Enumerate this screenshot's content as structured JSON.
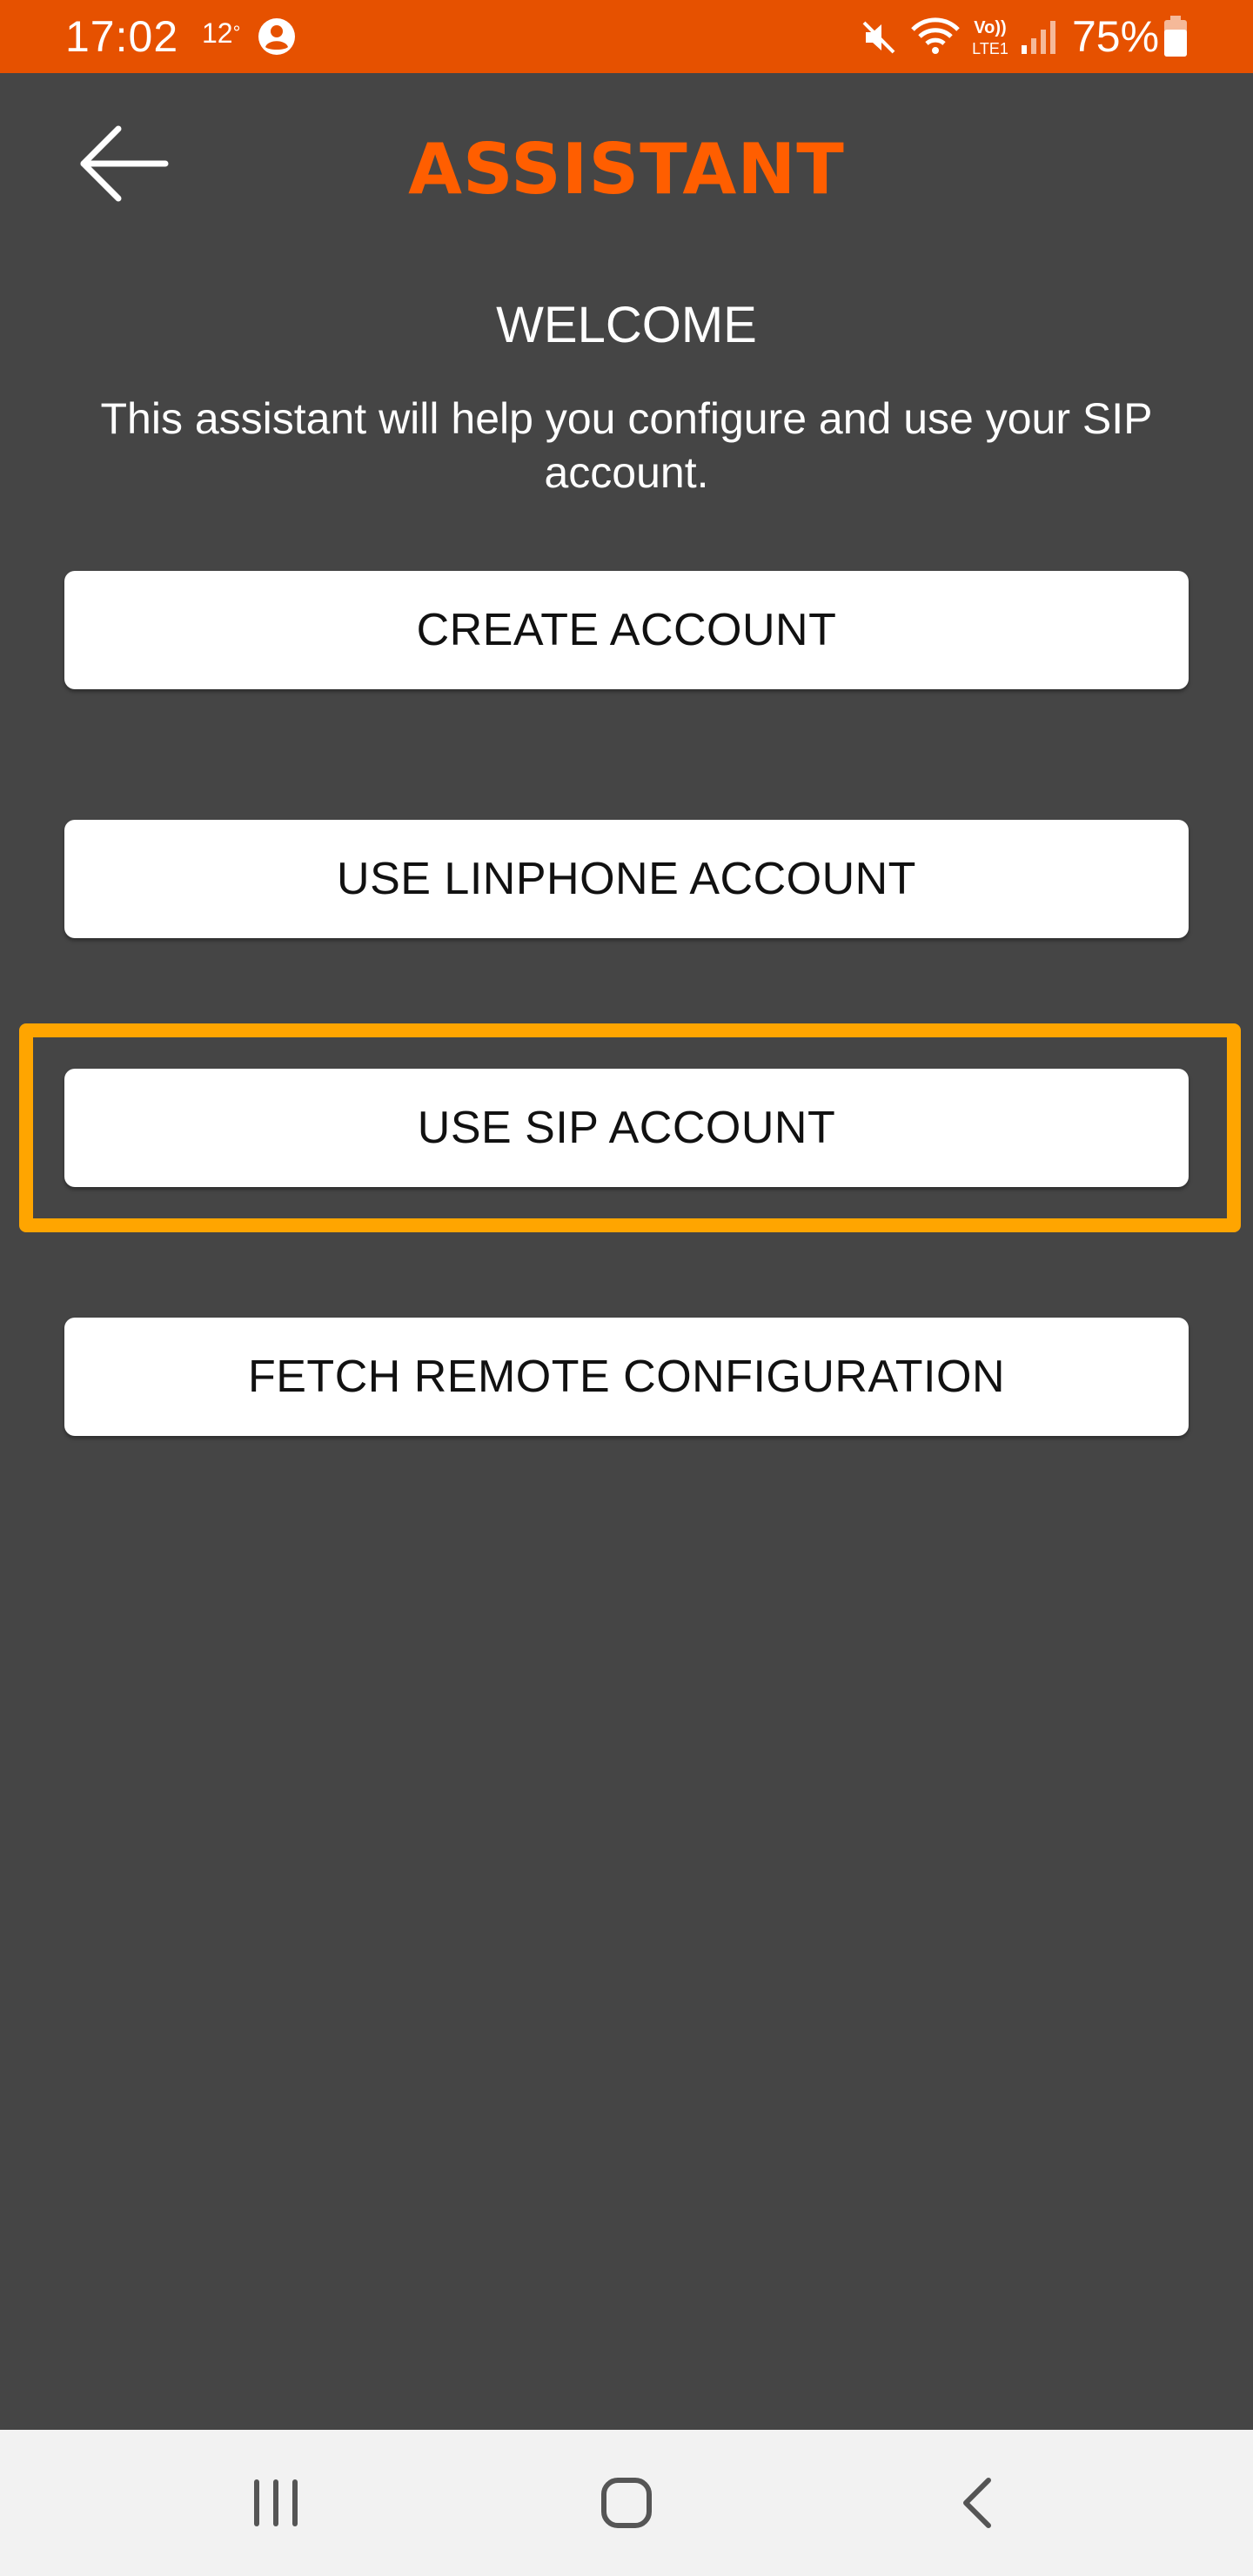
{
  "status_bar": {
    "time": "17:02",
    "temperature": "12",
    "temperature_unit": "°",
    "battery": "75%",
    "icons": [
      "person-icon",
      "mute-icon",
      "wifi-icon",
      "volte-icon",
      "signal-icon",
      "battery-icon"
    ],
    "background_color": "#e65100"
  },
  "header": {
    "title": "ASSISTANT",
    "title_color": "#ff5e00",
    "back_icon": "arrow-left-icon"
  },
  "welcome": {
    "heading": "WELCOME",
    "text": "This assistant will help you configure and use your SIP account."
  },
  "buttons": {
    "create_account": "CREATE ACCOUNT",
    "use_linphone_account": "USE LINPHONE ACCOUNT",
    "use_sip_account": "USE SIP ACCOUNT",
    "fetch_remote_configuration": "FETCH REMOTE CONFIGURATION"
  },
  "highlight_color": "#ffa500",
  "nav_bar": {
    "icons": [
      "recents-icon",
      "home-icon",
      "back-icon"
    ]
  }
}
